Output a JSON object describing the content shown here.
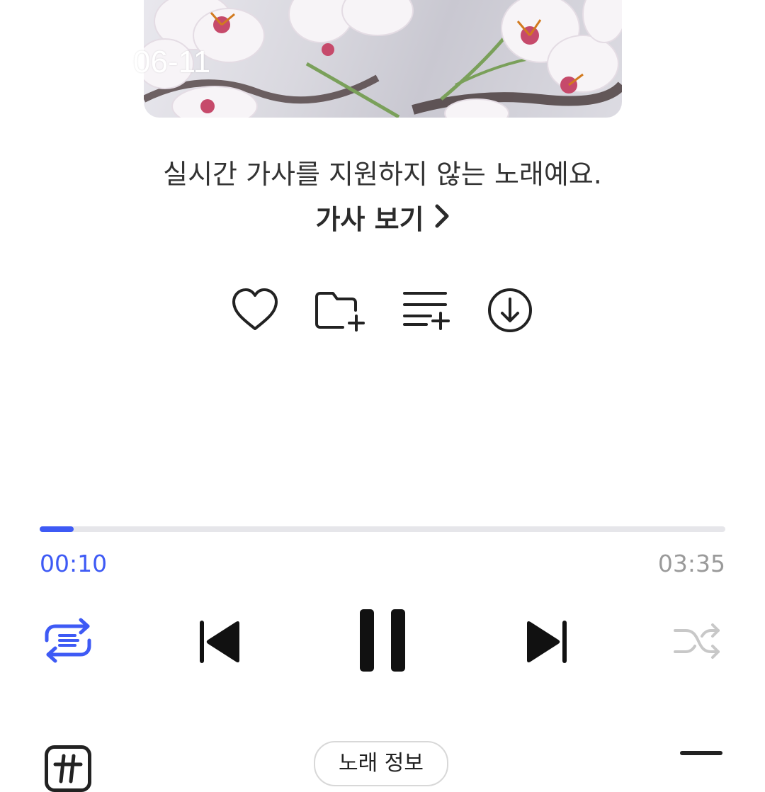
{
  "album": {
    "date_overlay": "06-11"
  },
  "lyrics": {
    "notice": "실시간 가사를 지원하지 않는 노래예요.",
    "view_label": "가사 보기"
  },
  "actions": [
    {
      "icon": "heart-icon"
    },
    {
      "icon": "folder-add-icon"
    },
    {
      "icon": "playlist-add-icon"
    },
    {
      "icon": "download-icon"
    }
  ],
  "playback": {
    "current_time": "00:10",
    "total_time": "03:35",
    "progress": 0.05,
    "accent_color": "#3e5af5"
  },
  "controls": {
    "repeat": "repeat-icon",
    "previous": "skip-previous-icon",
    "pause": "pause-icon",
    "next": "skip-next-icon",
    "shuffle": "shuffle-icon"
  },
  "bottom_bar": {
    "song_info_label": "노래 정보"
  }
}
